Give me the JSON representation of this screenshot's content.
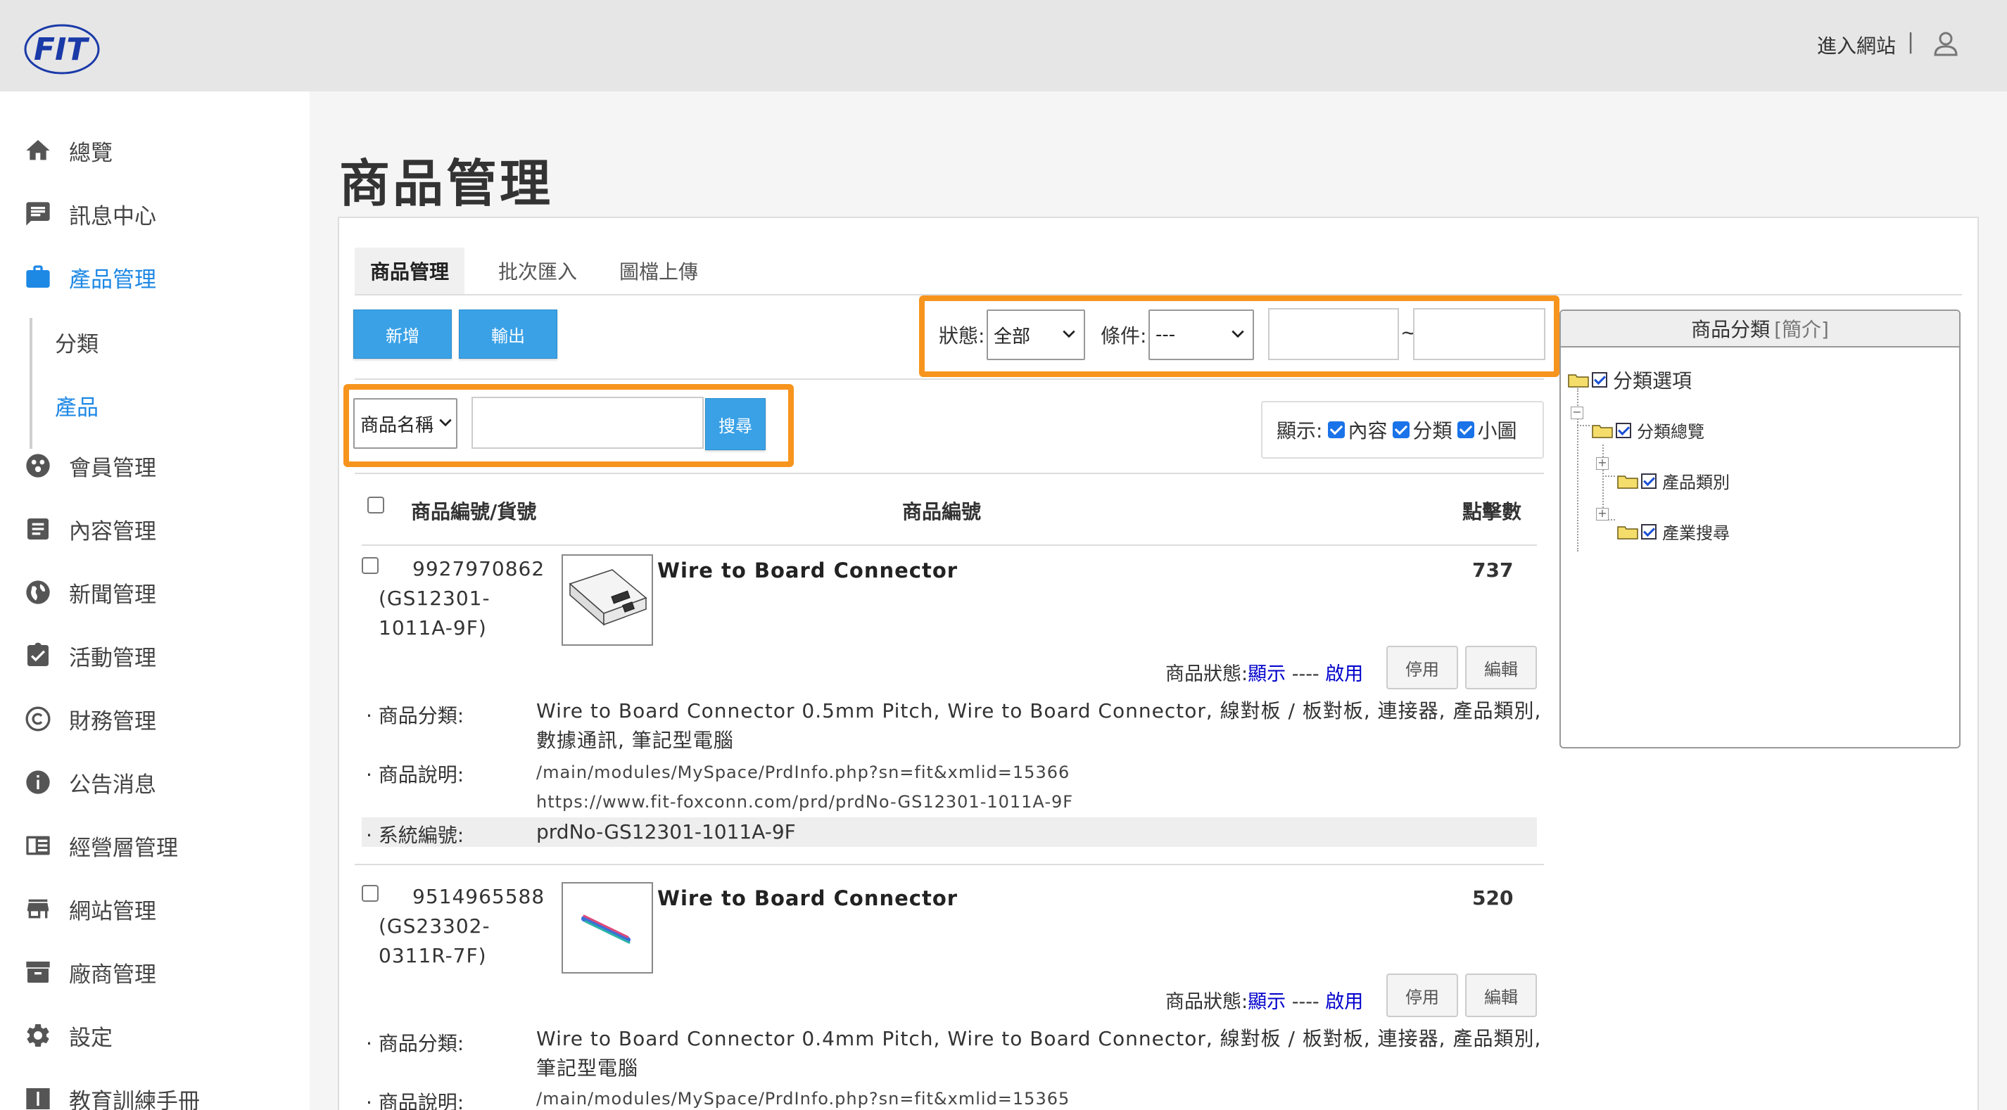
{
  "header": {
    "logo_text": "FIT",
    "site_link": "進入網站",
    "separator": "|",
    "user_icon": "user-icon"
  },
  "sidebar": {
    "items": [
      {
        "label": "總覽",
        "icon": "home-icon"
      },
      {
        "label": "訊息中心",
        "icon": "message-icon"
      },
      {
        "label": "產品管理",
        "icon": "briefcase-icon",
        "active": true
      },
      {
        "label": "會員管理",
        "icon": "members-icon"
      },
      {
        "label": "內容管理",
        "icon": "document-icon"
      },
      {
        "label": "新聞管理",
        "icon": "globe-icon"
      },
      {
        "label": "活動管理",
        "icon": "clipboard-check-icon"
      },
      {
        "label": "財務管理",
        "icon": "copyright-icon"
      },
      {
        "label": "公告消息",
        "icon": "info-icon"
      },
      {
        "label": "經營層管理",
        "icon": "book-icon"
      },
      {
        "label": "網站管理",
        "icon": "store-icon"
      },
      {
        "label": "廠商管理",
        "icon": "archive-icon"
      },
      {
        "label": "設定",
        "icon": "gear-icon"
      },
      {
        "label": "教育訓練手冊",
        "icon": "manual-icon"
      }
    ],
    "sub_items": [
      {
        "label": "分類"
      },
      {
        "label": "產品",
        "active": true
      }
    ]
  },
  "main": {
    "title": "商品管理",
    "tabs": [
      {
        "label": "商品管理",
        "active": true
      },
      {
        "label": "批次匯入"
      },
      {
        "label": "圖檔上傳"
      }
    ],
    "buttons": {
      "add": "新增",
      "export": "輸出",
      "search": "搜尋"
    },
    "filters": {
      "status_label": "狀態:",
      "status_value": "全部",
      "condition_label": "條件:",
      "condition_value": "---",
      "range_sep": "~",
      "search_field_value": "商品名稱"
    },
    "display": {
      "label": "顯示:",
      "options": [
        "內容",
        "分類",
        "小圖"
      ]
    },
    "table": {
      "col_id": "商品編號/貨號",
      "col_name": "商品編號",
      "col_clicks": "點擊數"
    },
    "labels": {
      "status_prefix": "商品狀態:",
      "status_show": "顯示",
      "status_dash": "----",
      "status_enabled": "啟用",
      "btn_disable": "停用",
      "btn_edit": "編輯",
      "category": "· 商品分類:",
      "description": "· 商品說明:",
      "system_no": "· 系統編號:"
    },
    "products": [
      {
        "id": "9927970862",
        "part_line1": "(GS12301-",
        "part_line2": "1011A-9F)",
        "name": "Wire to Board Connector",
        "clicks": "737",
        "category_line1": "Wire to Board Connector 0.5mm Pitch, Wire to Board Connector, 線對板 / 板對板, 連接器, 產品類別,",
        "category_line2": "數據通訊, 筆記型電腦",
        "desc_line1": "/main/modules/MySpace/PrdInfo.php?sn=fit&xmlid=15366",
        "desc_line2": "https://www.fit-foxconn.com/prd/prdNo-GS12301-1011A-9F",
        "system_no": "prdNo-GS12301-1011A-9F"
      },
      {
        "id": "9514965588",
        "part_line1": "(GS23302-",
        "part_line2": "0311R-7F)",
        "name": "Wire to Board Connector",
        "clicks": "520",
        "category_line1": "Wire to Board Connector 0.4mm Pitch, Wire to Board Connector, 線對板 / 板對板, 連接器, 產品類別,",
        "category_line2": "筆記型電腦",
        "desc_line1": "/main/modules/MySpace/PrdInfo.php?sn=fit&xmlid=15365"
      }
    ]
  },
  "category_panel": {
    "title": "商品分類",
    "intro": "[簡介]",
    "nodes": [
      "分類選項",
      "分類總覽",
      "產品類別",
      "產業搜尋"
    ]
  },
  "colors": {
    "accent": "#1e88e5",
    "highlight": "#f7941d",
    "button_blue": "#3aa1e6"
  }
}
